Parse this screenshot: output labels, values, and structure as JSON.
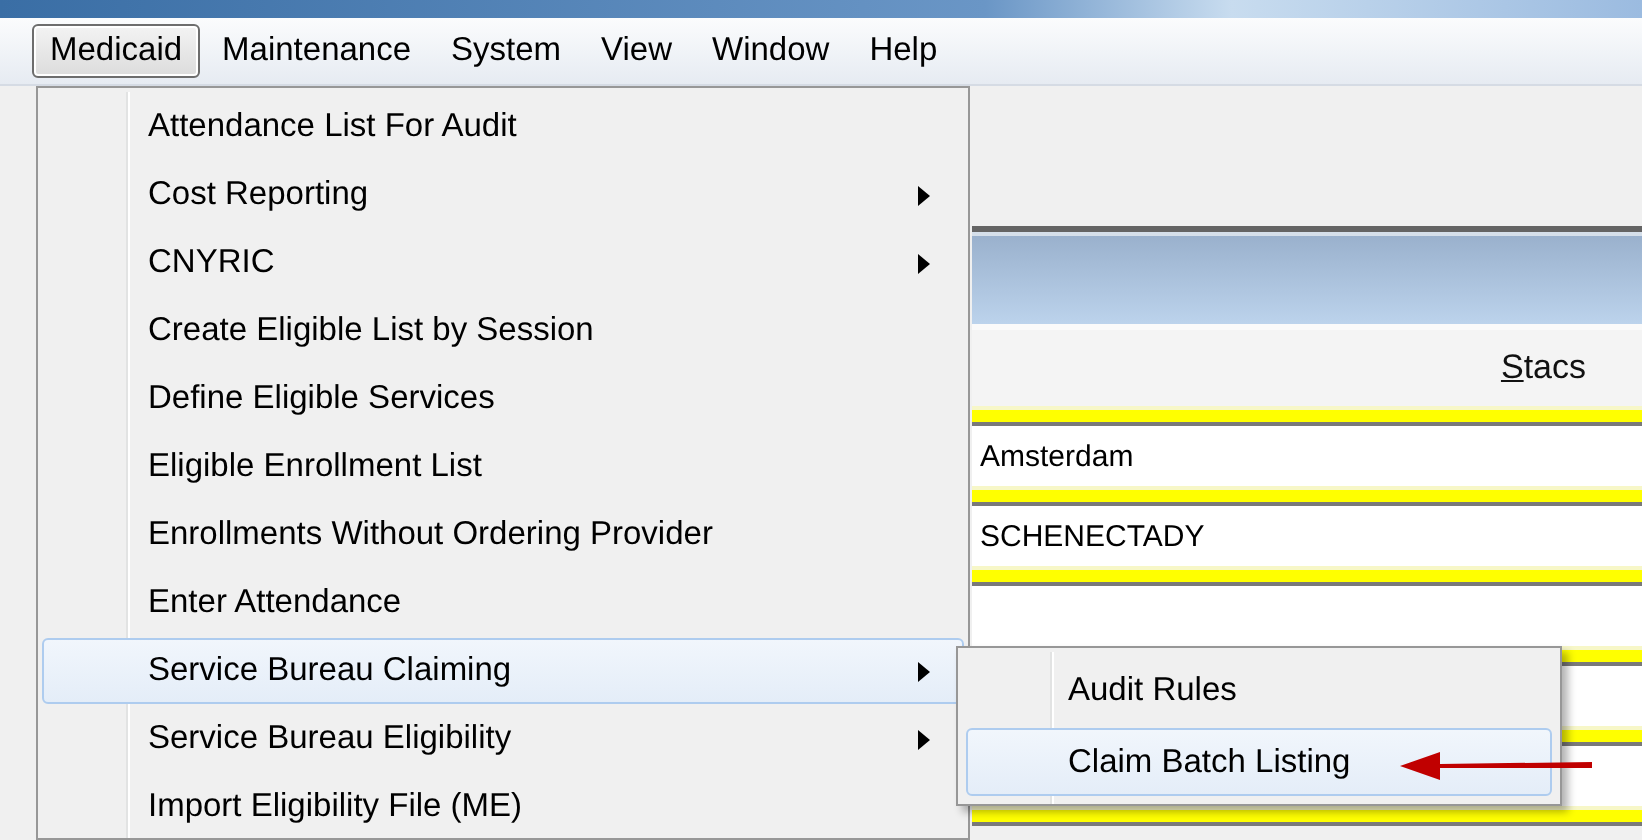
{
  "menu_bar": [
    {
      "label": "Medicaid",
      "selected": true
    },
    {
      "label": "Maintenance",
      "selected": false
    },
    {
      "label": "System",
      "selected": false
    },
    {
      "label": "View",
      "selected": false
    },
    {
      "label": "Window",
      "selected": false
    },
    {
      "label": "Help",
      "selected": false
    }
  ],
  "menu": [
    {
      "label": "Attendance List For Audit",
      "submenu": false,
      "selected": false
    },
    {
      "label": "Cost Reporting",
      "submenu": true,
      "selected": false
    },
    {
      "label": "CNYRIC",
      "submenu": true,
      "selected": false
    },
    {
      "label": "Create Eligible List by Session",
      "submenu": false,
      "selected": false
    },
    {
      "label": "Define Eligible Services",
      "submenu": false,
      "selected": false
    },
    {
      "label": "Eligible Enrollment List",
      "submenu": false,
      "selected": false
    },
    {
      "label": "Enrollments Without Ordering Provider",
      "submenu": false,
      "selected": false
    },
    {
      "label": "Enter Attendance",
      "submenu": false,
      "selected": false
    },
    {
      "label": "Service Bureau Claiming",
      "submenu": true,
      "selected": true
    },
    {
      "label": "Service Bureau Eligibility",
      "submenu": true,
      "selected": false
    },
    {
      "label": "Import Eligibility File (ME)",
      "submenu": false,
      "selected": false
    }
  ],
  "submenu": [
    {
      "label": "Audit Rules",
      "selected": false
    },
    {
      "label": "Claim Batch Listing",
      "selected": true
    }
  ],
  "form": {
    "column_header": {
      "label": "Stacs",
      "mnemonic": true
    },
    "rows": [
      {
        "value": "Amsterdam"
      },
      {
        "value": "SCHENECTADY"
      },
      {},
      {},
      {}
    ]
  },
  "annotation": {
    "kind": "arrow"
  }
}
